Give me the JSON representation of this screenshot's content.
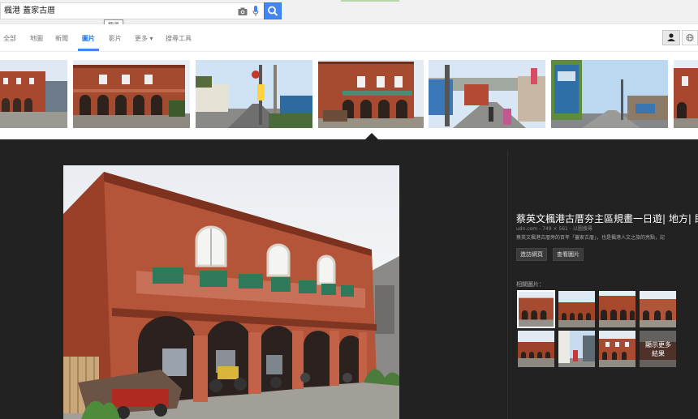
{
  "search": {
    "query": "楓港 蓋家古厝",
    "tooltip": "搜尋",
    "icons": [
      "camera-icon",
      "mic-icon",
      "search-icon"
    ]
  },
  "tabs": [
    {
      "label": "全部"
    },
    {
      "label": "地圖"
    },
    {
      "label": "新聞"
    },
    {
      "label": "圖片",
      "active": true
    },
    {
      "label": "影片"
    },
    {
      "label": "更多 ▾"
    },
    {
      "label": "搜尋工具"
    }
  ],
  "thumbnails_count": 7,
  "preview": {
    "title": "蔡英文楓港古厝夯主區規畫一日遊| 地方| 即",
    "meta": "udn.com - 749 × 561 - 以圖搜尋",
    "description": "蔡英文楓港古厝旁的百年「蓋家古厝」，也是楓港人文之旅的亮點，記",
    "visit_label": "造訪網頁",
    "view_label": "查看圖片",
    "related_label": "相關圖片：",
    "more_label": "顯示更多結果"
  },
  "colors": {
    "accent": "#4285f4",
    "panel_bg": "#222222",
    "brick": "#a8482e"
  }
}
